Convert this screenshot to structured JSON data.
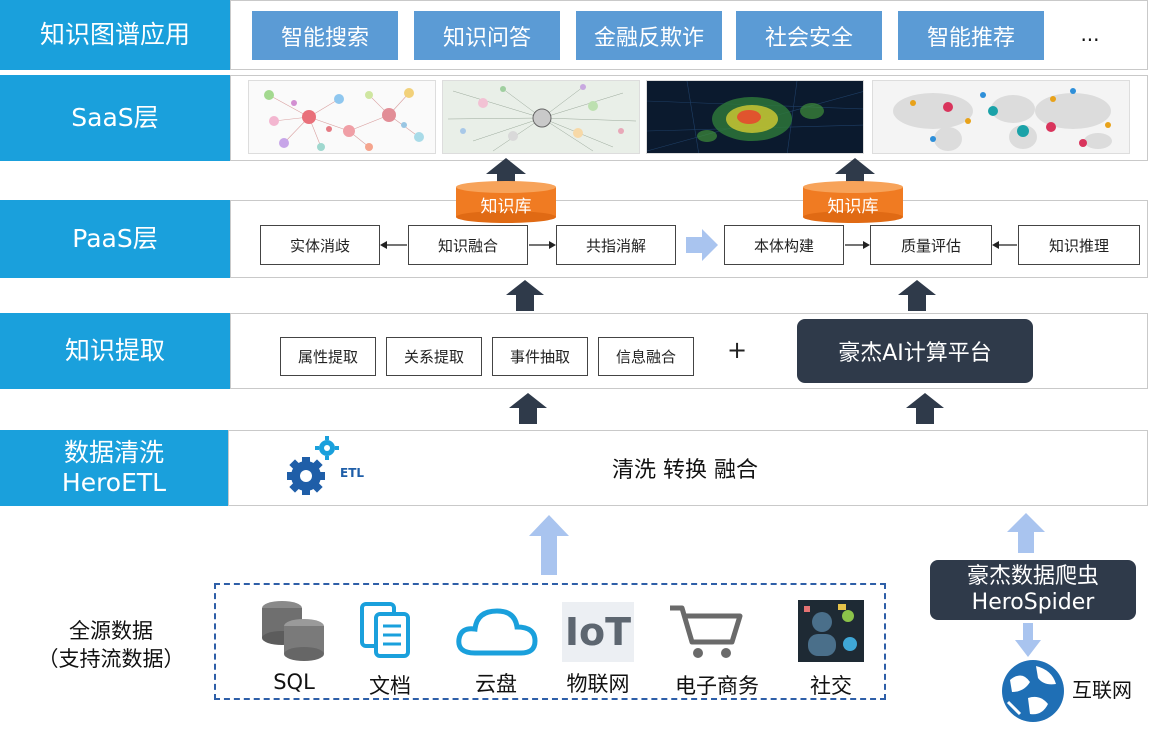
{
  "layers": {
    "apps": "知识图谱应用",
    "saas": "SaaS层",
    "paas": "PaaS层",
    "extract": "知识提取",
    "etl_line1": "数据清洗",
    "etl_line2": "HeroETL"
  },
  "apps": [
    "智能搜索",
    "知识问答",
    "金融反欺诈",
    "社会安全",
    "智能推荐",
    "..."
  ],
  "knowledge_base": "知识库",
  "paas_steps": [
    "实体消歧",
    "知识融合",
    "共指消解",
    "本体构建",
    "质量评估",
    "知识推理"
  ],
  "extract_steps": [
    "属性提取",
    "关系提取",
    "事件抽取",
    "信息融合"
  ],
  "plus": "+",
  "ai_platform": "豪杰AI计算平台",
  "etl_logo_text": "ETL",
  "etl_desc": "清洗 转换 融合",
  "source": {
    "title_line1": "全源数据",
    "title_line2": "（支持流数据）",
    "items": [
      "SQL",
      "文档",
      "云盘",
      "物联网",
      "电子商务",
      "社交"
    ],
    "iot_text": "IoT"
  },
  "spider": {
    "line1": "豪杰数据爬虫",
    "line2": "HeroSpider"
  },
  "internet": "互联网",
  "colors": {
    "layer_blue": "#1aa0dc",
    "app_blue": "#5b9bd5",
    "dark": "#2f3a4a",
    "kb_orange": "#f07b22",
    "arrow_dark": "#2f3a4a",
    "arrow_light": "#a9c4ef"
  }
}
